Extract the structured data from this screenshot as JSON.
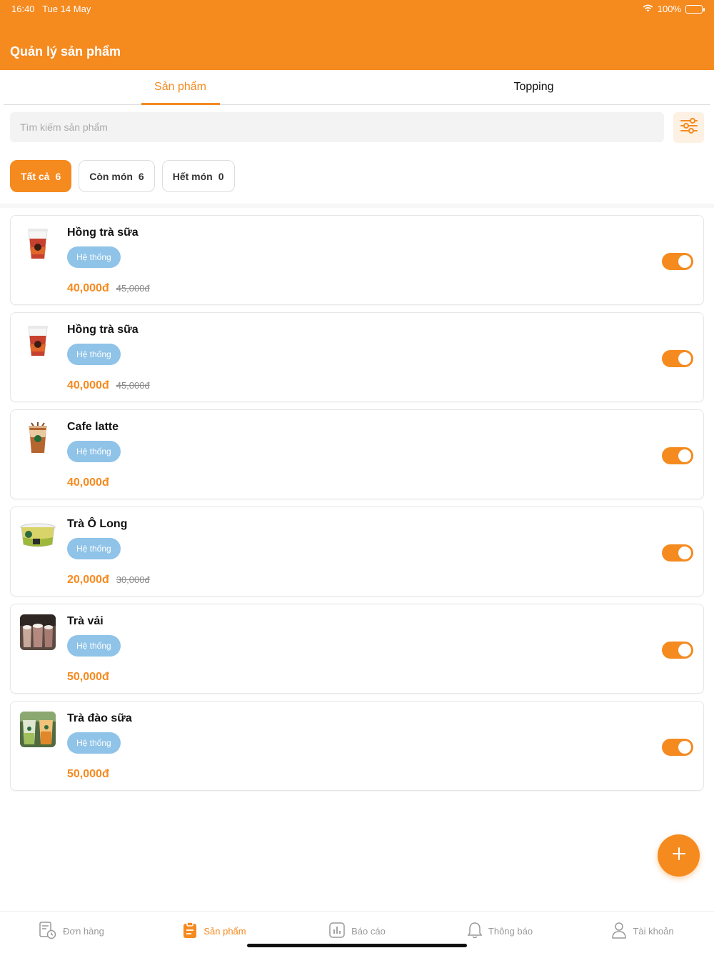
{
  "status_bar": {
    "time": "16:40",
    "date": "Tue 14 May",
    "battery": "100%"
  },
  "header": {
    "title": "Quản lý sản phẩm"
  },
  "tabs": [
    {
      "label": "Sản phẩm",
      "active": true
    },
    {
      "label": "Topping",
      "active": false
    }
  ],
  "search": {
    "placeholder": "Tìm kiếm sản phẩm",
    "value": ""
  },
  "filter_icon": "sliders-icon",
  "chips": [
    {
      "label": "Tất cả",
      "count": "6",
      "active": true
    },
    {
      "label": "Còn món",
      "count": "6",
      "active": false
    },
    {
      "label": "Hết món",
      "count": "0",
      "active": false
    }
  ],
  "products": [
    {
      "name": "Hồng trà sữa",
      "badge": "Hệ thống",
      "price": "40,000đ",
      "old_price": "45,000đ",
      "enabled": true,
      "image": "milk-tea-cup"
    },
    {
      "name": "Hồng trà sữa",
      "badge": "Hệ thống",
      "price": "40,000đ",
      "old_price": "45,000đ",
      "enabled": true,
      "image": "milk-tea-cup"
    },
    {
      "name": "Cafe latte",
      "badge": "Hệ thống",
      "price": "40,000đ",
      "old_price": "",
      "enabled": true,
      "image": "latte-cup"
    },
    {
      "name": "Trà Ô Long",
      "badge": "Hệ thống",
      "price": "20,000đ",
      "old_price": "30,000đ",
      "enabled": true,
      "image": "oolong-glass"
    },
    {
      "name": "Trà vải",
      "badge": "Hệ thống",
      "price": "50,000đ",
      "old_price": "",
      "enabled": true,
      "image": "lychee-tea-photo"
    },
    {
      "name": "Trà đào sữa",
      "badge": "Hệ thống",
      "price": "50,000đ",
      "old_price": "",
      "enabled": true,
      "image": "peach-tea-photo"
    }
  ],
  "fab": {
    "icon": "plus-icon"
  },
  "bottom_nav": [
    {
      "label": "Đơn hàng",
      "icon": "orders-icon",
      "active": false
    },
    {
      "label": "Sản phẩm",
      "icon": "clipboard-icon",
      "active": true
    },
    {
      "label": "Báo cáo",
      "icon": "chart-icon",
      "active": false
    },
    {
      "label": "Thông báo",
      "icon": "bell-icon",
      "active": false
    },
    {
      "label": "Tài khoản",
      "icon": "user-icon",
      "active": false
    }
  ],
  "colors": {
    "accent": "#F58A1F",
    "badge": "#8FC3E8",
    "filter_bg": "#FDF1E3"
  }
}
